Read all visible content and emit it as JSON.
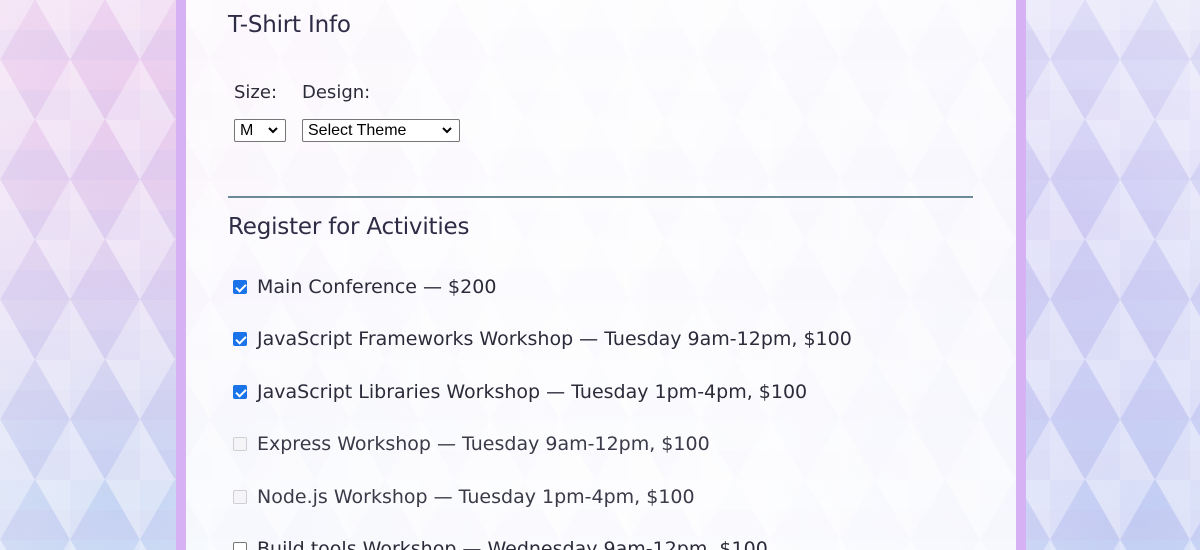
{
  "tshirt": {
    "title": "T-Shirt Info",
    "size_label": "Size:",
    "size_value": "M",
    "design_label": "Design:",
    "design_value": "Select Theme"
  },
  "activities": {
    "title": "Register for Activities",
    "items": [
      {
        "label": "Main Conference — $200",
        "checked": true,
        "disabled": false
      },
      {
        "label": "JavaScript Frameworks Workshop — Tuesday 9am-12pm, $100",
        "checked": true,
        "disabled": false
      },
      {
        "label": "JavaScript Libraries Workshop — Tuesday 1pm-4pm, $100",
        "checked": true,
        "disabled": false
      },
      {
        "label": "Express Workshop — Tuesday 9am-12pm, $100",
        "checked": false,
        "disabled": true
      },
      {
        "label": "Node.js Workshop — Tuesday 1pm-4pm, $100",
        "checked": false,
        "disabled": true
      },
      {
        "label": "Build tools Workshop — Wednesday 9am-12pm, $100",
        "checked": false,
        "disabled": false
      }
    ]
  },
  "colors": {
    "border_accent": "#d6b2f4",
    "checkbox_checked": "#1a73e8",
    "divider": "#6b8a98"
  }
}
